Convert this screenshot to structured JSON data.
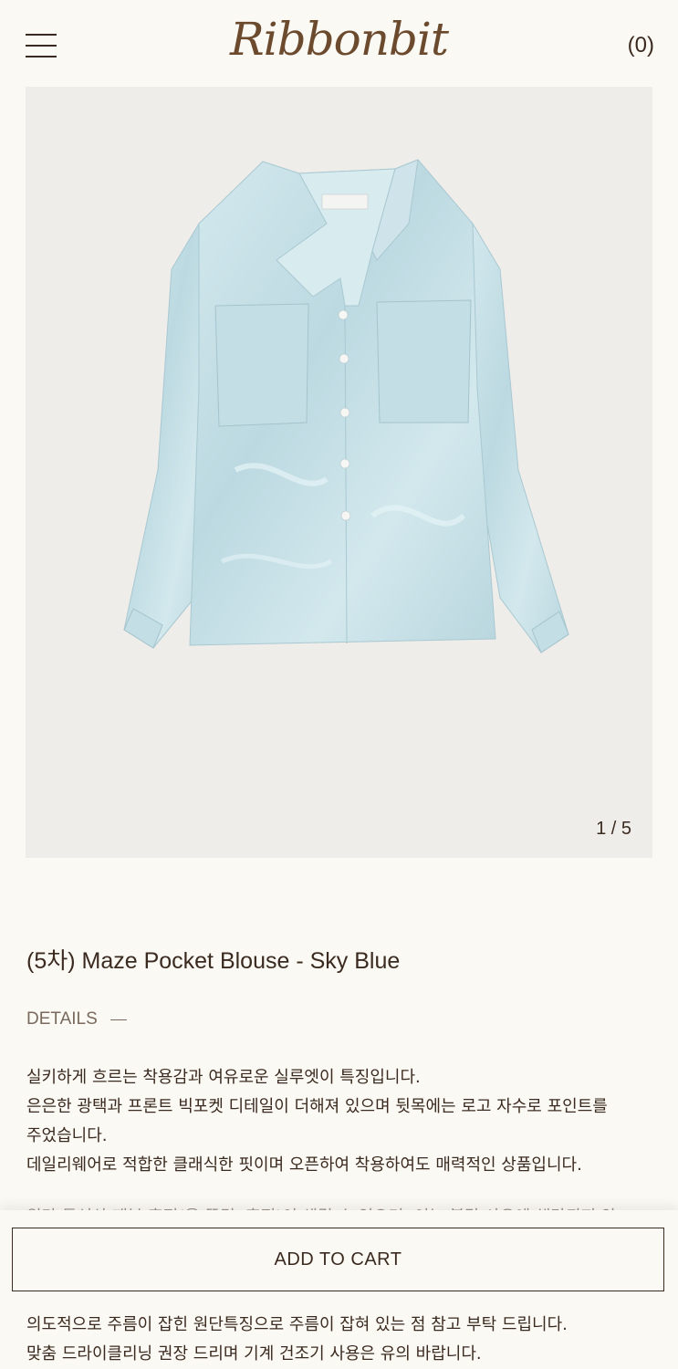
{
  "header": {
    "logo_text": "Ribbonbit",
    "cart_count": "(0)"
  },
  "gallery": {
    "pager": "1 / 5",
    "image_description_icon": "blouse-photo"
  },
  "product": {
    "title": "(5차) Maze Pocket Blouse - Sky Blue",
    "details_label": "DETAILS"
  },
  "description": {
    "lines": [
      "실키하게 흐르는 착용감과 여유로운 실루엣이 특징입니다.",
      "은은한 광택과 프론트 빅포켓 디테일이 더해져 있으며 뒷목에는 로고 자수로 포인트를",
      "주었습니다.",
      "데일리웨어로 적합한 클래식한 핏이며 오픈하여 착용하여도 매력적인 상품입니다."
    ],
    "faded_line": "원단 특성상 재봉 흔적(올 뜯김, 흔적)이 생길 수 있으며, 이는 불량 사유에 해당되지 않",
    "bottom_lines": [
      "의도적으로 주름이 잡힌 원단특징으로 주름이 잡혀 있는 점 참고 부탁 드립니다.",
      "맞춤 드라이클리닝 권장 드리며 기계 건조기 사용은 유의 바랍니다."
    ]
  },
  "cart_bar": {
    "add_to_cart_label": "ADD TO CART"
  },
  "colors": {
    "background": "#fbf9f4",
    "text": "#3b2a1f",
    "logo": "#6b4a2e",
    "image_bg": "#eeedea",
    "blouse": "#c9e1e7"
  }
}
